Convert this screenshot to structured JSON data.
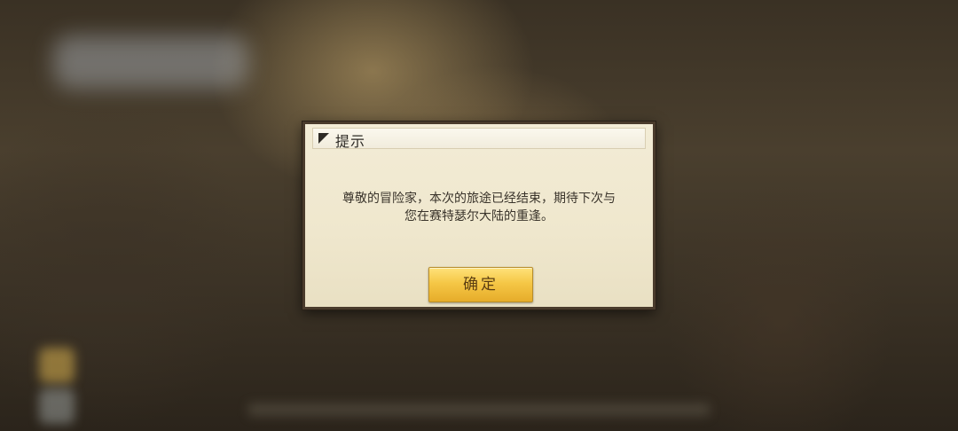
{
  "dialog": {
    "title": "提示",
    "message_lines": [
      "尊敬的冒险家，本次的旅途已经结束，期待下次与",
      "您在赛特瑟尔大陆的重逢。"
    ],
    "confirm_label": "确定"
  },
  "colors": {
    "dialog_background": "#efe7cd",
    "dialog_border": "#4a3b2c",
    "button_gold": "#f5c746",
    "button_text": "#5a3d12"
  },
  "icons": {
    "header_corner": "corner-triangle-icon"
  }
}
